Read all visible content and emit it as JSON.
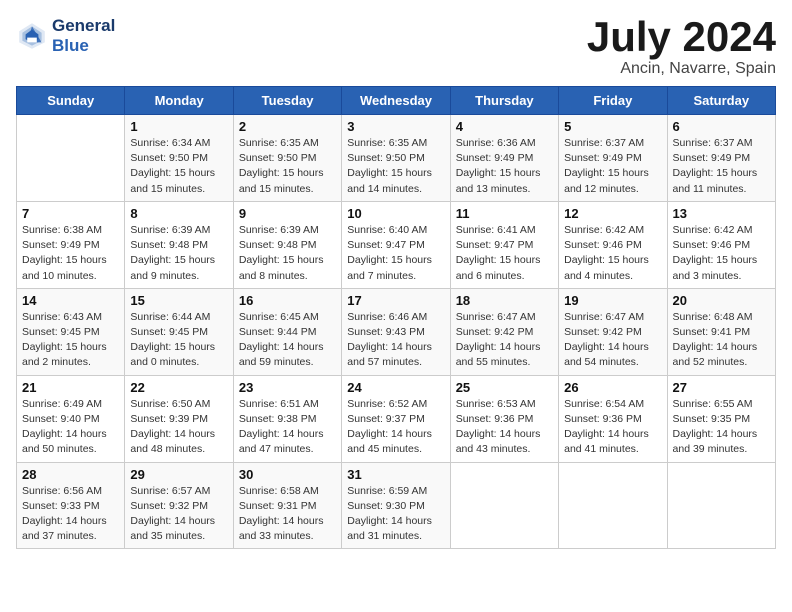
{
  "logo": {
    "line1": "General",
    "line2": "Blue"
  },
  "title": "July 2024",
  "location": "Ancin, Navarre, Spain",
  "weekdays": [
    "Sunday",
    "Monday",
    "Tuesday",
    "Wednesday",
    "Thursday",
    "Friday",
    "Saturday"
  ],
  "weeks": [
    [
      {
        "day": "",
        "info": ""
      },
      {
        "day": "1",
        "info": "Sunrise: 6:34 AM\nSunset: 9:50 PM\nDaylight: 15 hours\nand 15 minutes."
      },
      {
        "day": "2",
        "info": "Sunrise: 6:35 AM\nSunset: 9:50 PM\nDaylight: 15 hours\nand 15 minutes."
      },
      {
        "day": "3",
        "info": "Sunrise: 6:35 AM\nSunset: 9:50 PM\nDaylight: 15 hours\nand 14 minutes."
      },
      {
        "day": "4",
        "info": "Sunrise: 6:36 AM\nSunset: 9:49 PM\nDaylight: 15 hours\nand 13 minutes."
      },
      {
        "day": "5",
        "info": "Sunrise: 6:37 AM\nSunset: 9:49 PM\nDaylight: 15 hours\nand 12 minutes."
      },
      {
        "day": "6",
        "info": "Sunrise: 6:37 AM\nSunset: 9:49 PM\nDaylight: 15 hours\nand 11 minutes."
      }
    ],
    [
      {
        "day": "7",
        "info": "Sunrise: 6:38 AM\nSunset: 9:49 PM\nDaylight: 15 hours\nand 10 minutes."
      },
      {
        "day": "8",
        "info": "Sunrise: 6:39 AM\nSunset: 9:48 PM\nDaylight: 15 hours\nand 9 minutes."
      },
      {
        "day": "9",
        "info": "Sunrise: 6:39 AM\nSunset: 9:48 PM\nDaylight: 15 hours\nand 8 minutes."
      },
      {
        "day": "10",
        "info": "Sunrise: 6:40 AM\nSunset: 9:47 PM\nDaylight: 15 hours\nand 7 minutes."
      },
      {
        "day": "11",
        "info": "Sunrise: 6:41 AM\nSunset: 9:47 PM\nDaylight: 15 hours\nand 6 minutes."
      },
      {
        "day": "12",
        "info": "Sunrise: 6:42 AM\nSunset: 9:46 PM\nDaylight: 15 hours\nand 4 minutes."
      },
      {
        "day": "13",
        "info": "Sunrise: 6:42 AM\nSunset: 9:46 PM\nDaylight: 15 hours\nand 3 minutes."
      }
    ],
    [
      {
        "day": "14",
        "info": "Sunrise: 6:43 AM\nSunset: 9:45 PM\nDaylight: 15 hours\nand 2 minutes."
      },
      {
        "day": "15",
        "info": "Sunrise: 6:44 AM\nSunset: 9:45 PM\nDaylight: 15 hours\nand 0 minutes."
      },
      {
        "day": "16",
        "info": "Sunrise: 6:45 AM\nSunset: 9:44 PM\nDaylight: 14 hours\nand 59 minutes."
      },
      {
        "day": "17",
        "info": "Sunrise: 6:46 AM\nSunset: 9:43 PM\nDaylight: 14 hours\nand 57 minutes."
      },
      {
        "day": "18",
        "info": "Sunrise: 6:47 AM\nSunset: 9:42 PM\nDaylight: 14 hours\nand 55 minutes."
      },
      {
        "day": "19",
        "info": "Sunrise: 6:47 AM\nSunset: 9:42 PM\nDaylight: 14 hours\nand 54 minutes."
      },
      {
        "day": "20",
        "info": "Sunrise: 6:48 AM\nSunset: 9:41 PM\nDaylight: 14 hours\nand 52 minutes."
      }
    ],
    [
      {
        "day": "21",
        "info": "Sunrise: 6:49 AM\nSunset: 9:40 PM\nDaylight: 14 hours\nand 50 minutes."
      },
      {
        "day": "22",
        "info": "Sunrise: 6:50 AM\nSunset: 9:39 PM\nDaylight: 14 hours\nand 48 minutes."
      },
      {
        "day": "23",
        "info": "Sunrise: 6:51 AM\nSunset: 9:38 PM\nDaylight: 14 hours\nand 47 minutes."
      },
      {
        "day": "24",
        "info": "Sunrise: 6:52 AM\nSunset: 9:37 PM\nDaylight: 14 hours\nand 45 minutes."
      },
      {
        "day": "25",
        "info": "Sunrise: 6:53 AM\nSunset: 9:36 PM\nDaylight: 14 hours\nand 43 minutes."
      },
      {
        "day": "26",
        "info": "Sunrise: 6:54 AM\nSunset: 9:36 PM\nDaylight: 14 hours\nand 41 minutes."
      },
      {
        "day": "27",
        "info": "Sunrise: 6:55 AM\nSunset: 9:35 PM\nDaylight: 14 hours\nand 39 minutes."
      }
    ],
    [
      {
        "day": "28",
        "info": "Sunrise: 6:56 AM\nSunset: 9:33 PM\nDaylight: 14 hours\nand 37 minutes."
      },
      {
        "day": "29",
        "info": "Sunrise: 6:57 AM\nSunset: 9:32 PM\nDaylight: 14 hours\nand 35 minutes."
      },
      {
        "day": "30",
        "info": "Sunrise: 6:58 AM\nSunset: 9:31 PM\nDaylight: 14 hours\nand 33 minutes."
      },
      {
        "day": "31",
        "info": "Sunrise: 6:59 AM\nSunset: 9:30 PM\nDaylight: 14 hours\nand 31 minutes."
      },
      {
        "day": "",
        "info": ""
      },
      {
        "day": "",
        "info": ""
      },
      {
        "day": "",
        "info": ""
      }
    ]
  ]
}
